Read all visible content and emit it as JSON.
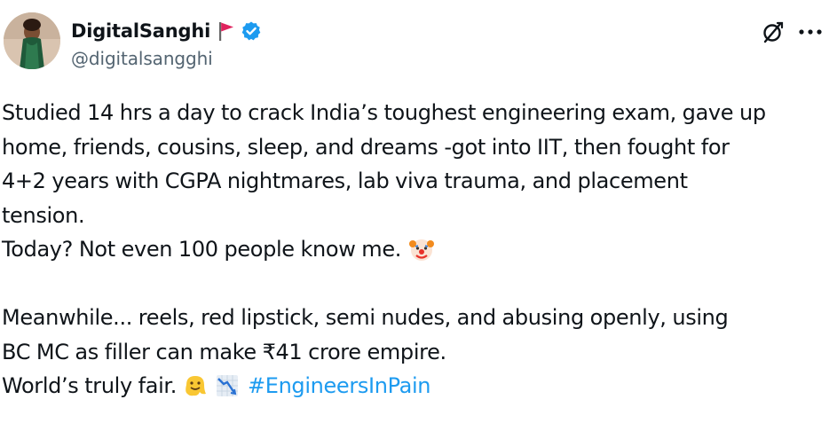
{
  "author": {
    "display_name": "DigitalSanghi",
    "handle": "@digitalsangghi",
    "verified": true
  },
  "icons": {
    "flag": "red-flag-icon",
    "verified": "verified-badge-icon",
    "grok": "grok-icon",
    "more": "more-options-icon",
    "clown": "clown-face-emoji",
    "melting": "melting-face-emoji",
    "chart": "chart-decreasing-emoji"
  },
  "colors": {
    "text": "#0f1419",
    "secondary": "#536471",
    "accent": "#1d9bf0",
    "flag": "#e0245e"
  },
  "tweet": {
    "lines": [
      "Studied 14 hrs a day to crack India’s toughest engineering exam, gave up",
      "home, friends, cousins, sleep, and dreams -got into IIT, then fought for",
      "4+2 years with CGPA nightmares, lab viva trauma, and placement",
      "tension.",
      "Today? Not even 100 people know me.",
      "Meanwhile... reels, red lipstick, semi nudes, and abusing openly, using",
      "BC MC as filler can make  ₹41 crore empire.",
      "World’s truly fair."
    ],
    "hashtag": "#EngineersInPain"
  }
}
